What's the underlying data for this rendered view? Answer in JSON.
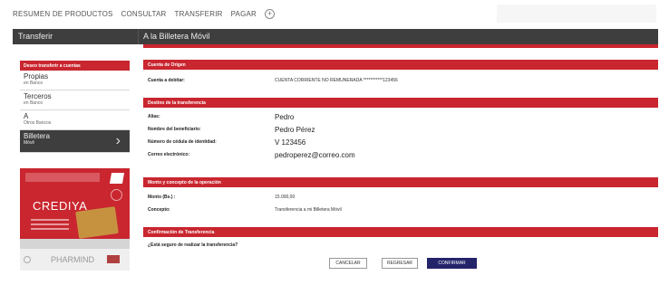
{
  "topnav": {
    "items": [
      "RESUMEN DE PRODUCTOS",
      "CONSULTAR",
      "TRANSFERIR",
      "PAGAR"
    ],
    "more_icon": "plus-circle-icon"
  },
  "titlebar": {
    "section": "Transferir",
    "subsection": "A la Billetera Móvil"
  },
  "sidebar": {
    "header": "Deseo transferir a cuentas",
    "items": [
      {
        "main": "Propias",
        "sub": "en Banco"
      },
      {
        "main": "Terceros",
        "sub": "en Banco"
      },
      {
        "main": "A",
        "sub": "Otros Bancos"
      },
      {
        "main": "Billetera",
        "sub": "Móvil"
      }
    ]
  },
  "ad": {
    "logo": "CREDIYA",
    "brand": "PHARMIND"
  },
  "origin": {
    "header": "Cuenta de Origen",
    "label": "Cuenta a debitar:",
    "value": "CUENTA CORRIENTE NO REMUNERADA ***********123456"
  },
  "destination": {
    "header": "Destino de la transferencia",
    "fields": [
      {
        "label": "Alias:",
        "value": "Pedro"
      },
      {
        "label": "Nombre del beneficiario:",
        "value": "Pedro Pérez"
      },
      {
        "label": "Número de cédula de identidad:",
        "value": "V 123456"
      },
      {
        "label": "Correo electrónico:",
        "value": "pedroperez@correo.com"
      }
    ]
  },
  "amount": {
    "header": "Monto y concepto de la operación",
    "fields": [
      {
        "label": "Monto (Bs.) :",
        "value": "15.000,00"
      },
      {
        "label": "Concepto:",
        "value": "Transferencia a mi Billetera Móvil"
      }
    ]
  },
  "confirm": {
    "header": "Confirmación de Transferencia",
    "question": "¿Está seguro de realizar la transferencia?",
    "cancel": "CANCELAR",
    "back": "REGRESAR",
    "ok": "CONFIRMAR"
  },
  "colors": {
    "accent_red": "#c9262f",
    "dark_bar": "#3e3e3e",
    "confirm_blue": "#24246b"
  }
}
